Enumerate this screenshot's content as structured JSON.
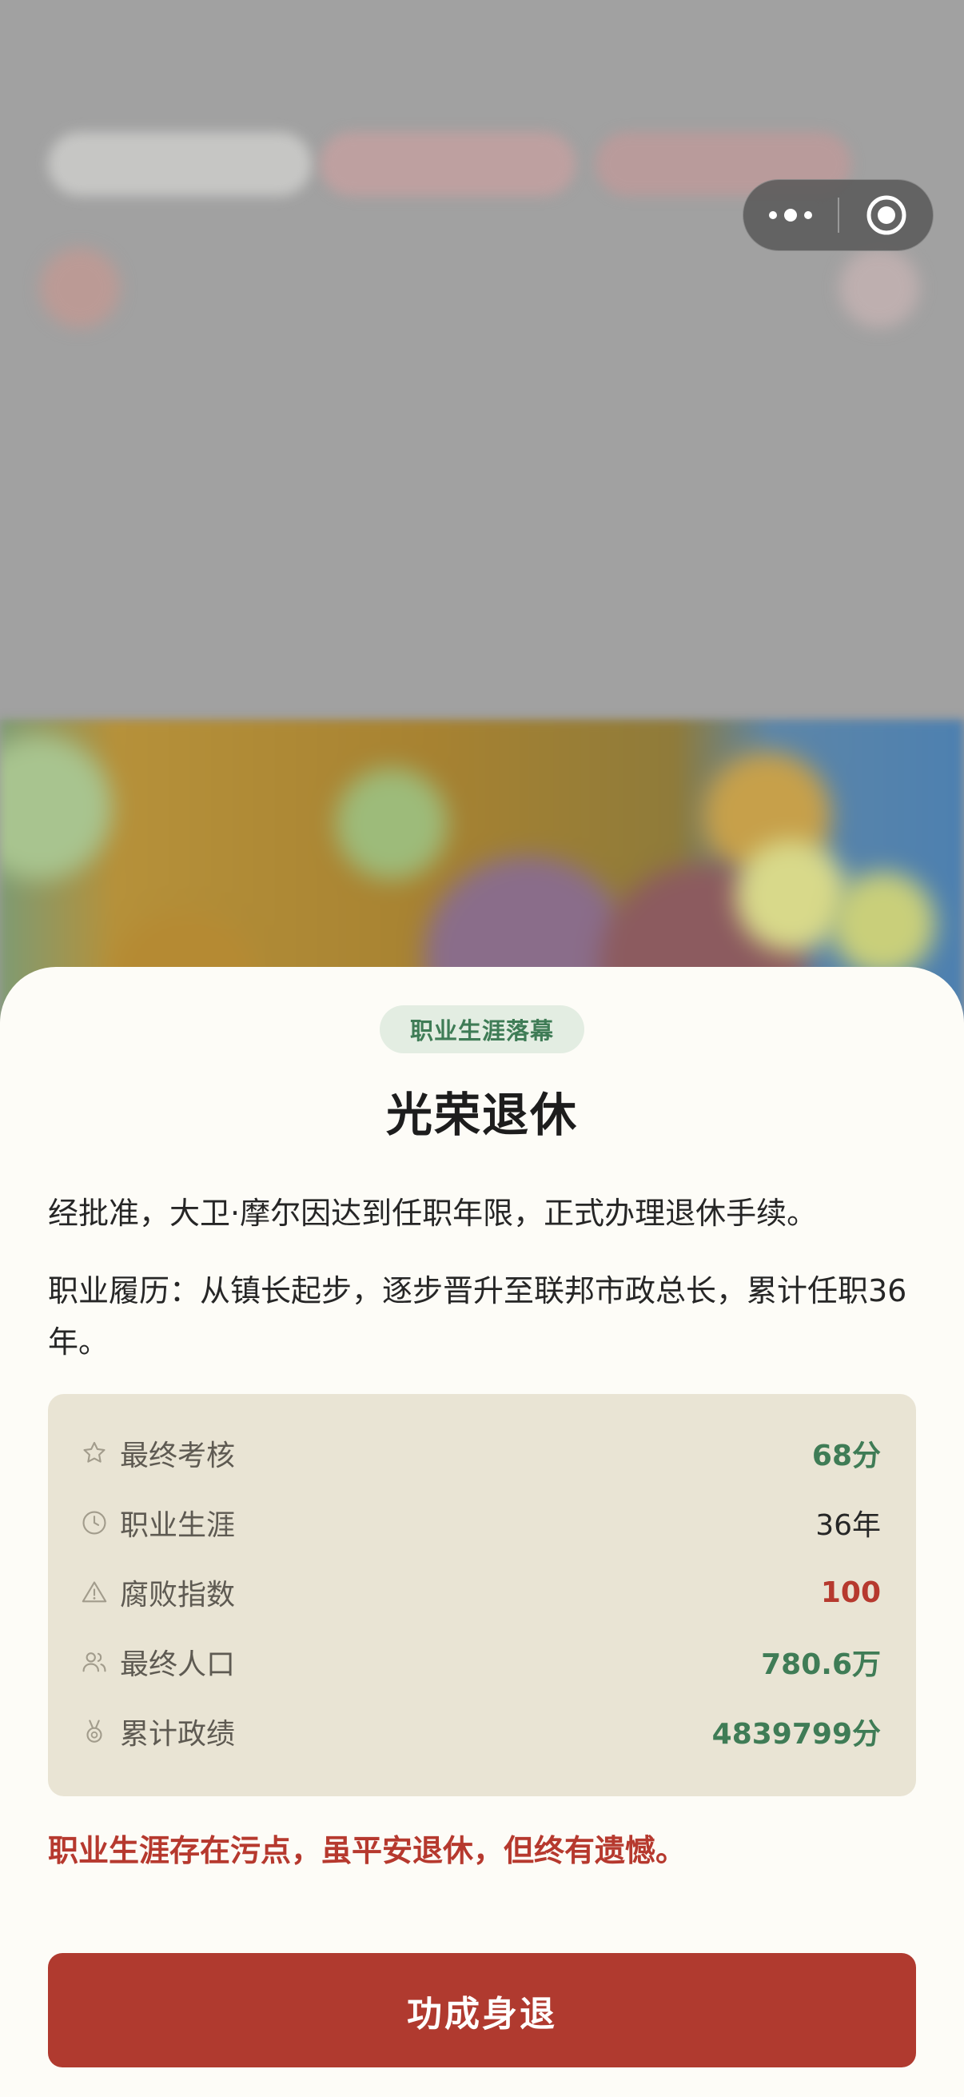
{
  "capsule": {
    "more_icon": "more-dots-icon",
    "close_icon": "target-close-icon"
  },
  "sheet": {
    "badge": "职业生涯落幕",
    "title": "光荣退休",
    "paragraph1": "经批准，大卫·摩尔因达到任职年限，正式办理退休手续。",
    "paragraph2": "职业履历：从镇长起步，逐步晋升至联邦市政总长，累计任职36年。",
    "stats": [
      {
        "icon": "star-icon",
        "label": "最终考核",
        "value": "68分",
        "tone": "green"
      },
      {
        "icon": "clock-icon",
        "label": "职业生涯",
        "value": "36年",
        "tone": "dark"
      },
      {
        "icon": "warning-icon",
        "label": "腐败指数",
        "value": "100",
        "tone": "red"
      },
      {
        "icon": "people-icon",
        "label": "最终人口",
        "value": "780.6万",
        "tone": "green"
      },
      {
        "icon": "medal-icon",
        "label": "累计政绩",
        "value": "4839799分",
        "tone": "green"
      }
    ],
    "warning": "职业生涯存在污点，虽平安退休，但终有遗憾。",
    "cta_label": "功成身退"
  },
  "colors": {
    "accent_green": "#3f7c56",
    "accent_red": "#b03a2f",
    "sheet_bg": "#fdfcf7",
    "stats_bg": "#e9e4d4"
  }
}
